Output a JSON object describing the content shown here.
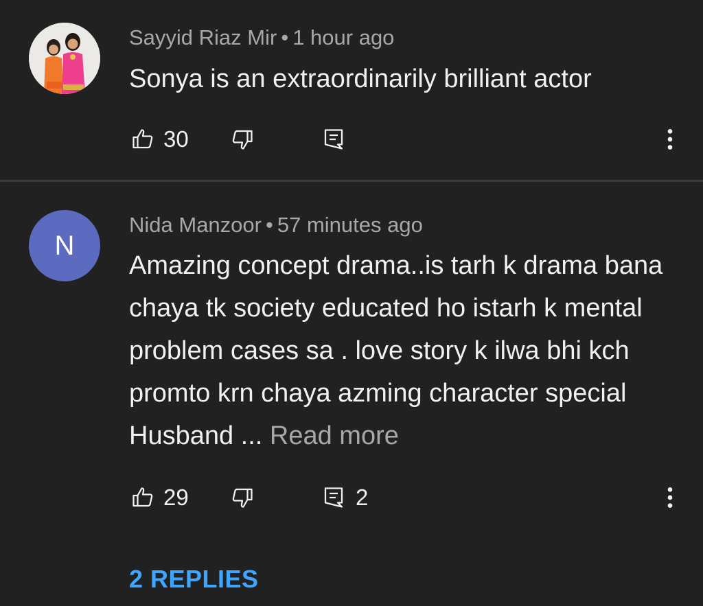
{
  "comments": [
    {
      "author": "Sayyid Riaz Mir",
      "separator": "•",
      "time": "1 hour ago",
      "text": "Sonya is an extraordinarily brilliant actor",
      "likes": "30",
      "avatar_type": "photo"
    },
    {
      "author": "Nida Manzoor",
      "separator": "•",
      "time": "57 minutes ago",
      "text": "Amazing concept drama..is tarh k drama bana chaya tk society educated ho istarh k mental problem cases sa  . love story k ilwa bhi kch promto krn chaya azming character special Husband ...",
      "read_more": "Read more",
      "likes": "29",
      "reply_count": "2",
      "avatar_letter": "N",
      "avatar_color": "#5c6bc0",
      "replies_label": "2 REPLIES"
    }
  ],
  "colors": {
    "background": "#212121",
    "text": "#f1f1f1",
    "secondary": "#a8a8a8",
    "link": "#3ea6ff"
  },
  "icons": [
    "thumbs-up-icon",
    "thumbs-down-icon",
    "reply-icon",
    "more-vert-icon"
  ]
}
